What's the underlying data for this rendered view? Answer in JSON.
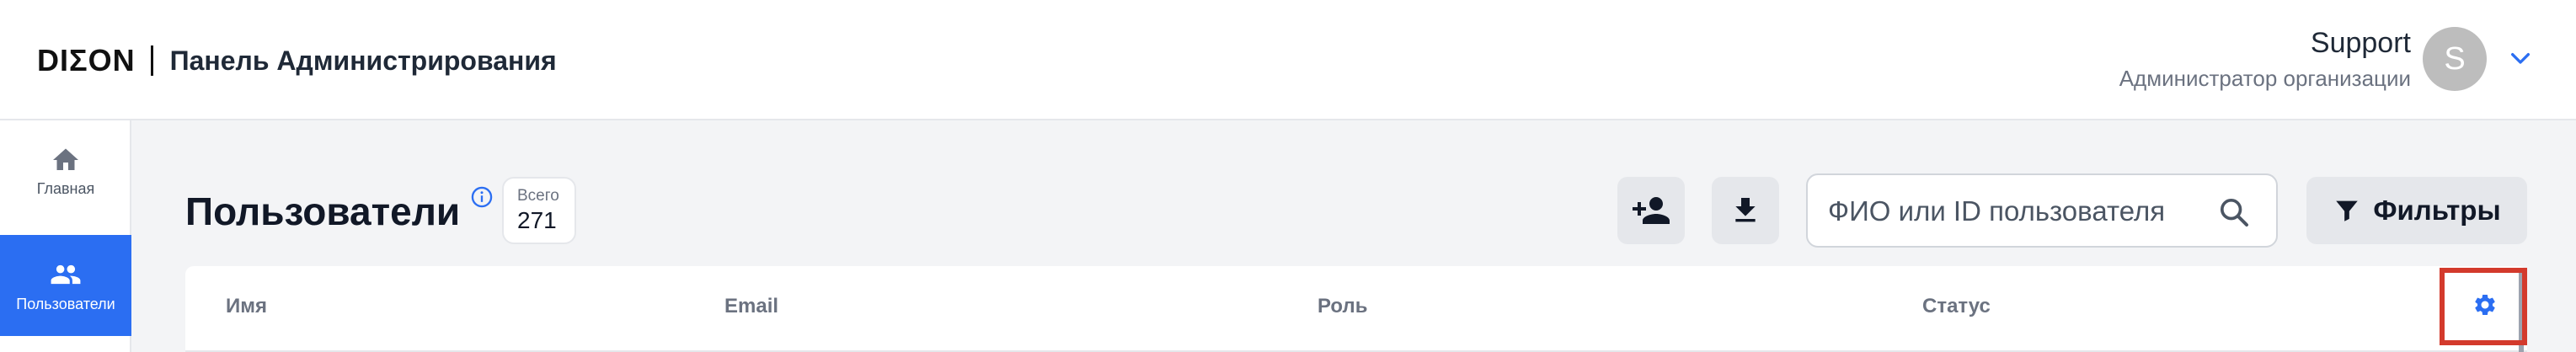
{
  "header": {
    "logo": "DIΣON",
    "app_title": "Панель Администрирования",
    "user": {
      "name": "Support",
      "role": "Администратор организации",
      "avatar_letter": "S"
    }
  },
  "sidebar": {
    "items": [
      {
        "label": "Главная",
        "icon": "home-icon"
      },
      {
        "label": "Пользователи",
        "icon": "users-icon"
      }
    ]
  },
  "main": {
    "title": "Пользователи",
    "total": {
      "label": "Всего",
      "value": "271"
    },
    "search": {
      "placeholder": "ФИО или ID пользователя"
    },
    "filter_label": "Фильтры",
    "table": {
      "columns": [
        "Имя",
        "Email",
        "Роль",
        "Статус"
      ]
    }
  },
  "colors": {
    "accent": "#2b6ef2",
    "highlight": "#d33a2c"
  }
}
